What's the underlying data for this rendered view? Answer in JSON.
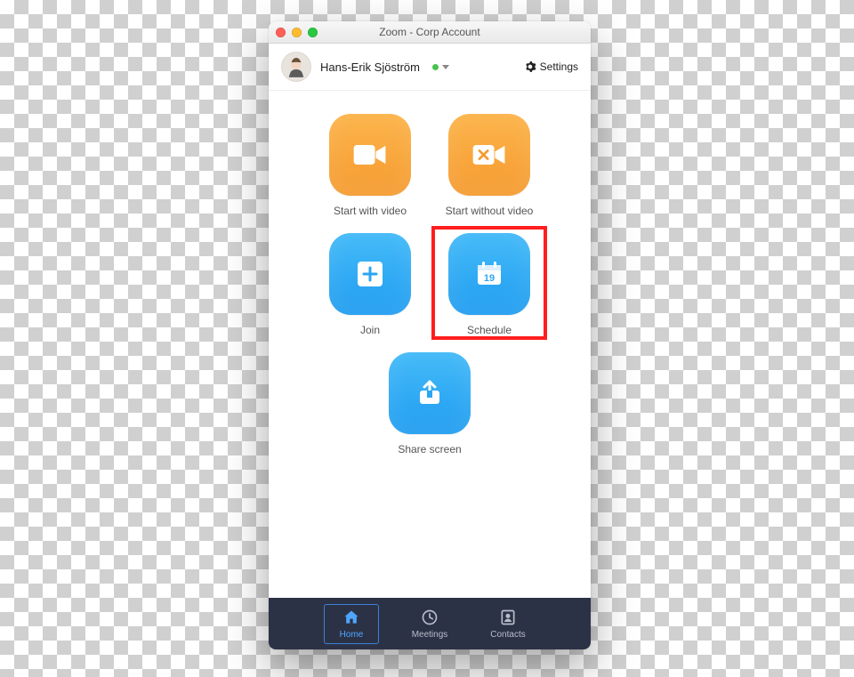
{
  "window": {
    "title": "Zoom - Corp Account"
  },
  "header": {
    "username": "Hans-Erik Sjöström",
    "settings_label": "Settings"
  },
  "tiles": {
    "start_with_video": "Start with video",
    "start_without_video": "Start without video",
    "join": "Join",
    "schedule": "Schedule",
    "schedule_calendar_day": "19",
    "share_screen": "Share screen"
  },
  "tabs": {
    "home": "Home",
    "meetings": "Meetings",
    "contacts": "Contacts"
  },
  "highlighted_tile": "schedule",
  "colors": {
    "orange_top": "#fcb54d",
    "orange_bottom": "#f59a2e",
    "blue_top": "#46bbf8",
    "blue_bottom": "#1e9cf0",
    "tabbar_bg": "#2c3246",
    "highlight": "#ff1e1e",
    "accent": "#4ea6ff"
  }
}
